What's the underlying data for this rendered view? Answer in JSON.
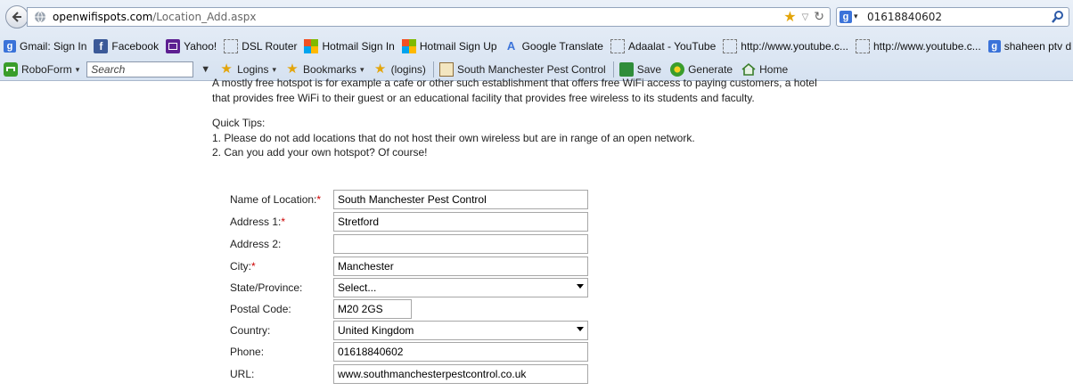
{
  "browser": {
    "url_domain": "openwifispots.com",
    "url_path": "/Location_Add.aspx",
    "search_query": "01618840602"
  },
  "bookmarks": [
    {
      "label": "Gmail: Sign In",
      "icon": "google-icon"
    },
    {
      "label": "Facebook",
      "icon": "facebook-icon"
    },
    {
      "label": "Yahoo!",
      "icon": "yahoo-mail-icon"
    },
    {
      "label": "DSL Router",
      "icon": "blank-page-icon"
    },
    {
      "label": "Hotmail Sign In",
      "icon": "msn-icon"
    },
    {
      "label": "Hotmail Sign Up",
      "icon": "msn-icon"
    },
    {
      "label": "Google Translate",
      "icon": "translate-icon"
    },
    {
      "label": "Adaalat - YouTube",
      "icon": "blank-page-icon"
    },
    {
      "label": "http://www.youtube.c...",
      "icon": "blank-page-icon"
    },
    {
      "label": "http://www.youtube.c...",
      "icon": "blank-page-icon"
    },
    {
      "label": "shaheen ptv d",
      "icon": "google-icon"
    }
  ],
  "toolbar": {
    "roboform": "RoboForm",
    "search_placeholder": "Search",
    "logins": "Logins",
    "bookmarks": "Bookmarks",
    "logins_paren": "(logins)",
    "passcard": "South Manchester Pest Control",
    "save": "Save",
    "generate": "Generate",
    "home": "Home"
  },
  "content": {
    "intro_line1": "A mostly free hotspot is for example a cafe or other such establishment that offers free WiFi access to paying customers, a hotel",
    "intro_line2": "that provides free WiFi to their guest or an educational facility that provides free wireless to its students and faculty.",
    "tips_title": "Quick Tips:",
    "tip1": "1. Please do not add locations that do not host their own wireless but are in range of an open network.",
    "tip2": "2. Can you add your own hotspot? Of course!"
  },
  "form": {
    "name_label": "Name of Location:",
    "name_value": "South Manchester Pest Control",
    "address1_label": "Address 1:",
    "address1_value": "Stretford",
    "address2_label": "Address 2:",
    "address2_value": "",
    "city_label": "City:",
    "city_value": "Manchester",
    "state_label": "State/Province:",
    "state_value": "Select...",
    "postal_label": "Postal Code:",
    "postal_value": "M20 2GS",
    "country_label": "Country:",
    "country_value": "United Kingdom",
    "phone_label": "Phone:",
    "phone_value": "01618840602",
    "url_label": "URL:",
    "url_value": "www.southmanchesterpestcontrol.co.uk",
    "required_mark": "*"
  }
}
